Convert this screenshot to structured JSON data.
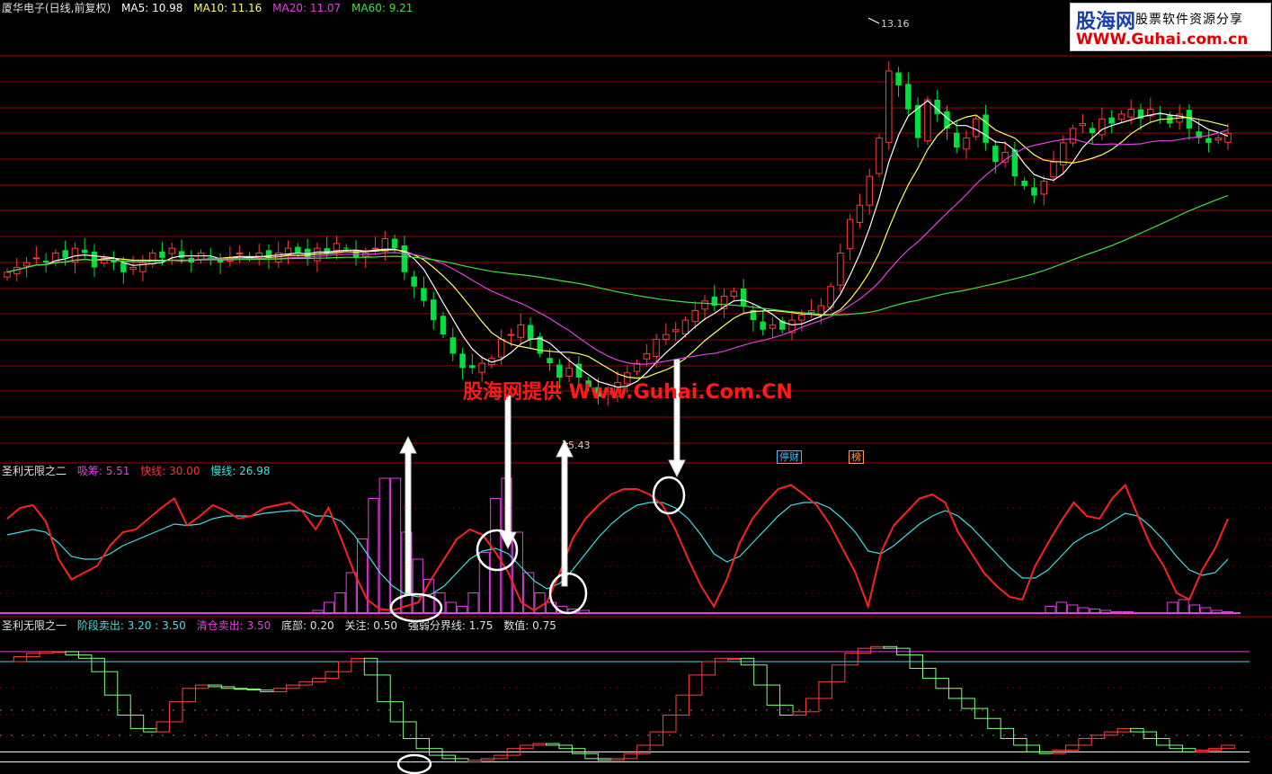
{
  "header": {
    "title": "厦华电子(日线,前复权)",
    "ma5": "MA5: 10.98",
    "ma10": "MA10: 11.16",
    "ma20": "MA20: 11.07",
    "ma60": "MA60: 9.21"
  },
  "logo": {
    "name": "股海网",
    "tagline": "股票软件资源分享",
    "url": "WWW.Guhai.com.cn"
  },
  "watermark": "股海网提供 Www.Guhai.Com.CN",
  "price_labels": {
    "high": "13.16",
    "low": "5.43"
  },
  "tags": {
    "tag1": "停财",
    "tag2": "榜"
  },
  "panel2": {
    "title": "圣利无限之二",
    "absorb": "吸筹: 5.51",
    "fast": "快线: 30.00",
    "slow": "慢线: 26.98"
  },
  "panel3": {
    "title": "圣利无限之一",
    "stage_sell": "阶段卖出: 3.20 : 3.50",
    "clear_sell": "清仓卖出: 3.50",
    "bottom": "底部: 0.20",
    "focus": "关注: 0.50",
    "weak_strong": "强弱分界线: 1.75",
    "value": "数值: 0.75"
  },
  "colors": {
    "up": "#ff3b3b",
    "down": "#00e040",
    "ma5": "#ffffff",
    "ma10": "#ffff66",
    "ma20": "#e040e0",
    "ma60": "#40e040",
    "fast": "#ff2020",
    "slow": "#40e0e0",
    "absorb": "#e040e0",
    "grid": "#a00000"
  },
  "chart_data": [
    {
      "type": "candlestick",
      "title": "厦华电子(日线,前复权)",
      "series_names": [
        "MA5",
        "MA10",
        "MA20",
        "MA60"
      ],
      "ylim": [
        4.5,
        13.6
      ],
      "high": 13.16,
      "low": 5.43,
      "closes": [
        8.2,
        8.3,
        8.4,
        8.5,
        8.4,
        8.6,
        8.5,
        8.7,
        8.6,
        8.3,
        8.5,
        8.4,
        8.2,
        8.3,
        8.4,
        8.6,
        8.5,
        8.7,
        8.5,
        8.4,
        8.6,
        8.5,
        8.4,
        8.5,
        8.6,
        8.5,
        8.6,
        8.5,
        8.6,
        8.7,
        8.6,
        8.5,
        8.7,
        8.6,
        8.8,
        8.7,
        8.5,
        8.6,
        8.7,
        8.9,
        8.7,
        8.2,
        7.9,
        7.6,
        7.2,
        6.9,
        6.5,
        6.2,
        6.2,
        6.3,
        6.4,
        6.8,
        6.9,
        7.1,
        6.8,
        6.5,
        6.3,
        6.0,
        6.2,
        6.0,
        5.8,
        5.6,
        5.7,
        5.9,
        6.1,
        6.3,
        6.5,
        6.8,
        6.9,
        7.0,
        7.2,
        7.4,
        7.6,
        7.5,
        7.7,
        7.8,
        7.5,
        7.2,
        7.0,
        7.1,
        7.0,
        7.2,
        7.3,
        7.4,
        7.5,
        7.9,
        8.6,
        9.3,
        9.6,
        10.2,
        11.0,
        12.4,
        12.1,
        11.6,
        11.0,
        11.8,
        11.5,
        11.2,
        10.8,
        11.0,
        11.4,
        10.9,
        10.5,
        10.7,
        10.2,
        10.0,
        9.8,
        10.1,
        10.5,
        10.9,
        11.2,
        11.3,
        11.1,
        11.4,
        11.3,
        11.5,
        11.6,
        11.4,
        11.6,
        11.5,
        11.3,
        11.5,
        11.2,
        11.0,
        10.9,
        11.0,
        11.1
      ]
    },
    {
      "type": "line",
      "title": "圣利无限之二",
      "series_names": [
        "吸筹",
        "快线",
        "慢线"
      ],
      "ylim": [
        0,
        100
      ],
      "fast": [
        70,
        78,
        80,
        68,
        40,
        25,
        30,
        35,
        50,
        60,
        62,
        70,
        78,
        85,
        65,
        72,
        80,
        76,
        70,
        72,
        78,
        80,
        82,
        75,
        62,
        78,
        55,
        30,
        10,
        3,
        2,
        5,
        8,
        25,
        40,
        55,
        62,
        58,
        45,
        30,
        8,
        2,
        8,
        30,
        55,
        70,
        80,
        88,
        92,
        92,
        88,
        80,
        62,
        40,
        20,
        5,
        25,
        52,
        70,
        82,
        92,
        95,
        88,
        80,
        66,
        48,
        30,
        5,
        45,
        65,
        75,
        85,
        88,
        82,
        60,
        45,
        30,
        20,
        12,
        10,
        35,
        52,
        68,
        82,
        72,
        70,
        85,
        95,
        72,
        50,
        35,
        15,
        10,
        32,
        48,
        70
      ],
      "slow": [
        58,
        60,
        62,
        60,
        52,
        42,
        40,
        40,
        44,
        50,
        54,
        58,
        62,
        66,
        65,
        66,
        70,
        72,
        72,
        72,
        74,
        75,
        76,
        76,
        72,
        72,
        68,
        58,
        44,
        30,
        20,
        14,
        12,
        14,
        20,
        30,
        40,
        46,
        48,
        44,
        34,
        24,
        18,
        22,
        32,
        44,
        56,
        66,
        74,
        80,
        82,
        82,
        78,
        70,
        58,
        44,
        38,
        42,
        52,
        62,
        72,
        80,
        82,
        82,
        78,
        70,
        60,
        46,
        44,
        50,
        58,
        66,
        72,
        76,
        72,
        64,
        54,
        44,
        34,
        26,
        26,
        32,
        42,
        52,
        58,
        62,
        68,
        74,
        72,
        64,
        54,
        42,
        32,
        28,
        30,
        40
      ],
      "absorb": [
        0,
        0,
        0,
        0,
        0,
        0,
        0,
        0,
        0,
        0,
        0,
        0,
        0,
        0,
        0,
        0,
        0,
        0,
        0,
        0,
        0,
        0,
        0,
        0,
        0,
        0,
        0,
        0,
        2,
        8,
        15,
        30,
        55,
        85,
        100,
        100,
        60,
        40,
        25,
        15,
        8,
        5,
        15,
        45,
        85,
        100,
        60,
        30,
        15,
        8,
        5,
        3,
        2,
        0,
        0,
        0,
        0,
        0,
        0,
        0,
        0,
        0,
        0,
        0,
        0,
        0,
        0,
        0,
        0,
        0,
        0,
        0,
        0,
        0,
        0,
        0,
        0,
        0,
        0,
        0,
        0,
        0,
        0,
        0,
        0,
        0,
        0,
        0,
        0,
        0,
        0,
        0,
        0,
        0,
        5,
        8,
        6,
        4,
        3,
        2,
        1,
        1,
        0,
        0,
        0,
        8,
        10,
        6,
        4,
        2,
        1
      ]
    },
    {
      "type": "line",
      "title": "圣利无限之一",
      "series_names": [
        "阶段卖出",
        "清仓卖出",
        "底部",
        "关注",
        "强弱分界线",
        "数值"
      ],
      "ylim": [
        0,
        3.9
      ],
      "thresholds": [
        3.5,
        3.2,
        1.75,
        1.0,
        0.5,
        0.2
      ],
      "values": [
        3.2,
        3.35,
        3.45,
        3.5,
        3.5,
        3.4,
        3.3,
        2.9,
        2.2,
        1.6,
        1.2,
        1.1,
        1.4,
        2.0,
        2.4,
        2.5,
        2.45,
        2.4,
        2.38,
        2.35,
        2.3,
        2.4,
        2.5,
        2.6,
        2.7,
        2.9,
        3.2,
        3.3,
        2.8,
        2.0,
        1.4,
        0.9,
        0.6,
        0.4,
        0.3,
        0.2,
        0.25,
        0.3,
        0.4,
        0.6,
        0.7,
        0.75,
        0.7,
        0.6,
        0.45,
        0.3,
        0.25,
        0.3,
        0.45,
        0.7,
        1.1,
        1.6,
        2.2,
        2.8,
        3.2,
        3.3,
        3.3,
        3.1,
        2.5,
        1.9,
        1.6,
        1.7,
        2.1,
        2.6,
        3.1,
        3.45,
        3.6,
        3.65,
        3.6,
        3.4,
        3.0,
        2.7,
        2.4,
        2.1,
        1.8,
        1.5,
        1.2,
        0.9,
        0.7,
        0.5,
        0.45,
        0.55,
        0.7,
        0.9,
        1.0,
        1.1,
        1.2,
        1.1,
        0.9,
        0.7,
        0.6,
        0.5,
        0.55,
        0.6,
        0.7
      ]
    }
  ]
}
